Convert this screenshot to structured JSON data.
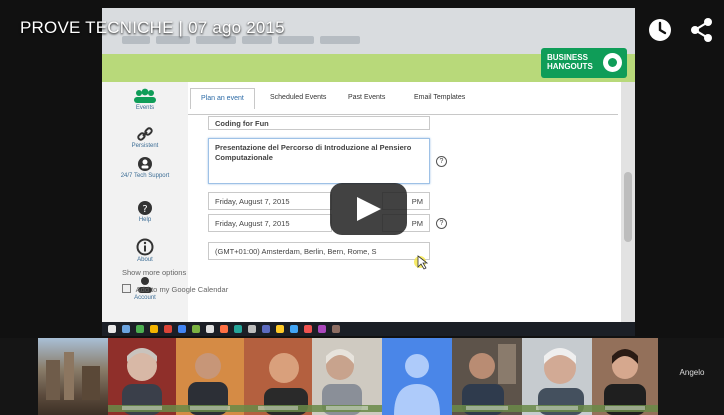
{
  "player": {
    "title": "PROVE TECNICHE | 07 ago 2015",
    "icons": [
      "clock-icon",
      "share-icon"
    ],
    "controls": [
      "play-icon"
    ]
  },
  "hangout": {
    "brand": "BUSINESS HANGOUTS",
    "sidebar": [
      {
        "icon": "people-icon",
        "label": "Events"
      },
      {
        "icon": "link-icon",
        "label": "Persistent"
      },
      {
        "icon": "support-icon",
        "label": "24/7 Tech Support"
      },
      {
        "icon": "question-icon",
        "label": "Help"
      },
      {
        "icon": "info-icon",
        "label": "About"
      },
      {
        "icon": "person-icon",
        "label": "Account"
      }
    ],
    "tabs": [
      "Plan an event",
      "Scheduled Events",
      "Past Events",
      "Email Templates"
    ],
    "form": {
      "event_name": "Coding for Fun",
      "description": "Presentazione del Percorso di Introduzione al Pensiero Computazionale",
      "start_date": "Friday, August 7, 2015",
      "start_time": "PM",
      "end_date": "Friday, August 7, 2015",
      "end_time": "PM",
      "timezone": "(GMT+01:00) Amsterdam, Berlin, Bern, Rome, S",
      "show_more": "Show more options",
      "calendar_checkbox": "Add to my Google Calendar"
    }
  },
  "participants": {
    "last_label": "Angelo"
  },
  "colors": {
    "accent_green": "#0f9d58",
    "band_green": "#b8d97a",
    "link_blue": "#2b6aa6",
    "player_bg": "#111111"
  }
}
